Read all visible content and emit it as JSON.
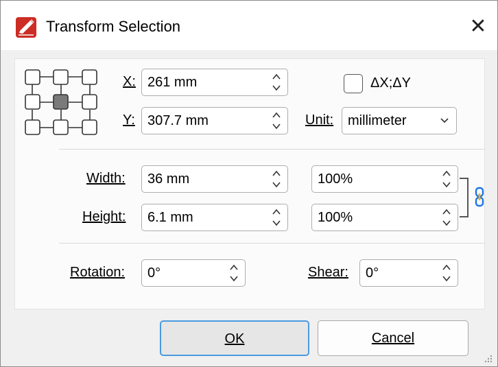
{
  "window": {
    "title": "Transform Selection",
    "close_glyph": "✕",
    "app_icon": "pdf-editor-icon",
    "accent_color": "#cc2d24"
  },
  "position": {
    "x_label": "X:",
    "x_value": "261 mm",
    "y_label": "Y:",
    "y_value": "307.7 mm",
    "delta_label": "ΔX;ΔY",
    "delta_checked": false,
    "unit_label": "Unit:",
    "unit_value": "millimeter",
    "anchor_grid_selected": "center",
    "anchor_icon": "anchor-point-grid-icon"
  },
  "size": {
    "width_label": "Width:",
    "width_value": "36 mm",
    "width_percent": "100%",
    "height_label": "Height:",
    "height_value": "6.1 mm",
    "height_percent": "100%",
    "link_icon": "chain-link-icon"
  },
  "transform": {
    "rotation_label": "Rotation:",
    "rotation_value": "0°",
    "shear_label": "Shear:",
    "shear_value": "0°"
  },
  "buttons": {
    "ok_label": "OK",
    "cancel_label": "Cancel"
  }
}
